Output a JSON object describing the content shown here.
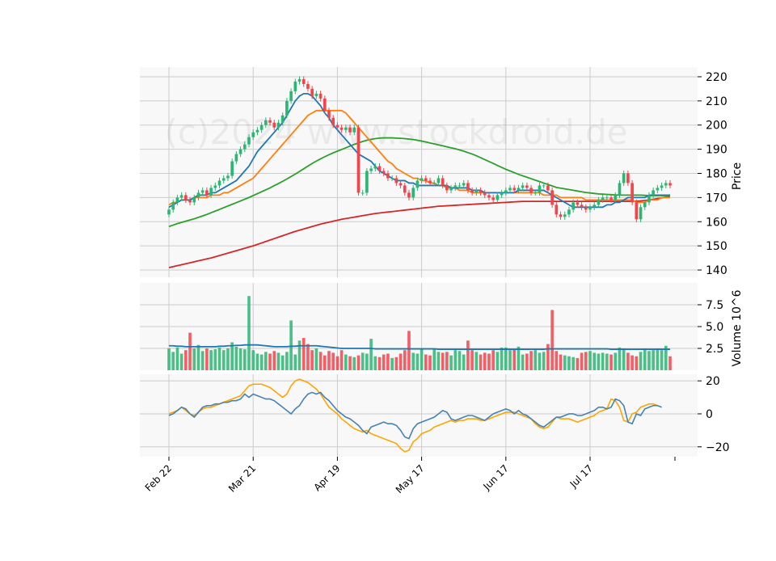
{
  "watermark": "(c)2024 www.stockdroid.de",
  "colors": {
    "up": "#2bb673",
    "down": "#f2444c",
    "ma1": "#1f77b4",
    "ma2": "#ff7f0e",
    "ma3": "#2ca02c",
    "ma4": "#d62728",
    "vol_ma": "#1f77b4",
    "osc_fast": "#4682b4",
    "osc_slow": "#ffa500",
    "panel_bg": "#f8f8f8",
    "grid": "#cccccc"
  },
  "chart_data": {
    "type": "candlestick",
    "x_tick_labels": [
      "Feb 22",
      "Mar 21",
      "Apr 19",
      "May 17",
      "Jun 17",
      "Jul 17"
    ],
    "x_tick_index": [
      0,
      20,
      40,
      60,
      80,
      100
    ],
    "panels": {
      "price": {
        "ylabel": "Price",
        "ylim": [
          137,
          224
        ],
        "yticks": [
          140,
          150,
          160,
          170,
          180,
          190,
          200,
          210,
          220
        ],
        "close": [
          165,
          168,
          170,
          171,
          169,
          168,
          170,
          172,
          173,
          171,
          174,
          175,
          177,
          178,
          179,
          185,
          188,
          190,
          192,
          195,
          197,
          198,
          200,
          202,
          201,
          199,
          201,
          204,
          210,
          214,
          218,
          219,
          217,
          215,
          212,
          213,
          211,
          206,
          203,
          200,
          199,
          198,
          199,
          197,
          199,
          172,
          172,
          181,
          182,
          183,
          181,
          180,
          178,
          178,
          176,
          175,
          172,
          170,
          174,
          177,
          178,
          177,
          176,
          176,
          178,
          175,
          173,
          174,
          175,
          175,
          176,
          173,
          172,
          173,
          172,
          171,
          170,
          169,
          171,
          172,
          173,
          174,
          173,
          174,
          175,
          174,
          172,
          172,
          175,
          175,
          173,
          167,
          163,
          162,
          163,
          165,
          168,
          167,
          166,
          165,
          166,
          167,
          169,
          170,
          170,
          169,
          171,
          176,
          180,
          176,
          168,
          161,
          166,
          168,
          171,
          173,
          174,
          175,
          176,
          175
        ],
        "ma_fast": [
          166,
          167,
          168,
          169,
          169,
          169,
          170,
          171,
          171,
          171,
          172,
          172,
          173,
          174,
          175,
          176,
          177,
          179,
          181,
          183,
          186,
          189,
          191,
          193,
          195,
          197,
          199,
          201,
          204,
          207,
          210,
          212,
          213,
          213,
          212,
          210,
          208,
          205,
          203,
          200,
          198,
          196,
          194,
          192,
          190,
          188,
          187,
          186,
          185,
          183,
          181,
          180,
          179,
          178,
          177,
          177,
          177,
          176,
          176,
          175,
          175,
          175,
          175,
          175,
          175,
          175,
          175,
          174,
          174,
          174,
          174,
          174,
          173,
          173,
          173,
          172,
          172,
          172,
          172,
          172,
          172,
          172,
          172,
          173,
          173,
          173,
          173,
          173,
          173,
          173,
          172,
          171,
          170,
          169,
          168,
          167,
          166,
          166,
          166,
          166,
          166,
          166,
          166,
          166,
          167,
          167,
          168,
          168,
          169,
          170,
          170,
          170,
          170,
          170,
          171,
          171,
          171,
          171,
          171,
          171
        ],
        "ma_mid": [
          167,
          168,
          168,
          169,
          169,
          169,
          170,
          170,
          170,
          170,
          171,
          171,
          171,
          172,
          172,
          173,
          174,
          175,
          176,
          177,
          178,
          180,
          182,
          184,
          186,
          188,
          190,
          192,
          194,
          196,
          198,
          200,
          202,
          204,
          205,
          206,
          206,
          206,
          206,
          206,
          206,
          206,
          205,
          203,
          201,
          199,
          197,
          195,
          193,
          191,
          189,
          187,
          185,
          184,
          182,
          181,
          180,
          179,
          178,
          178,
          177,
          177,
          176,
          176,
          175,
          175,
          174,
          174,
          174,
          173,
          173,
          173,
          172,
          172,
          172,
          172,
          172,
          172,
          172,
          172,
          172,
          172,
          172,
          172,
          172,
          172,
          172,
          172,
          172,
          171,
          171,
          171,
          171,
          170,
          170,
          170,
          170,
          170,
          170,
          169,
          169,
          169,
          169,
          169,
          169,
          169,
          169,
          169,
          169,
          169,
          169,
          168,
          168,
          168,
          169,
          169,
          169,
          170,
          170,
          170
        ],
        "ma_slow": [
          158,
          158.6,
          159.2,
          159.7,
          160.2,
          160.7,
          161.2,
          161.8,
          162.4,
          163.0,
          163.7,
          164.4,
          165.1,
          165.8,
          166.5,
          167.2,
          167.9,
          168.6,
          169.3,
          170.0,
          170.8,
          171.6,
          172.4,
          173.2,
          174.0,
          174.9,
          175.8,
          176.7,
          177.7,
          178.7,
          179.7,
          180.8,
          181.9,
          183.0,
          184.1,
          185.1,
          186.0,
          186.9,
          187.7,
          188.5,
          189.2,
          189.9,
          190.6,
          191.3,
          192.0,
          192.6,
          193.2,
          193.7,
          194.1,
          194.4,
          194.6,
          194.7,
          194.7,
          194.7,
          194.6,
          194.5,
          194.4,
          194.2,
          194.0,
          193.7,
          193.4,
          193.0,
          192.6,
          192.2,
          191.8,
          191.4,
          191.0,
          190.6,
          190.2,
          189.7,
          189.2,
          188.6,
          188.0,
          187.3,
          186.5,
          185.7,
          184.9,
          184.1,
          183.3,
          182.5,
          181.7,
          181.0,
          180.3,
          179.6,
          179.0,
          178.4,
          177.8,
          177.2,
          176.6,
          176.0,
          175.4,
          174.8,
          174.2,
          173.9,
          173.6,
          173.3,
          173.0,
          172.7,
          172.4,
          172.1,
          171.9,
          171.7,
          171.5,
          171.4,
          171.3,
          171.2,
          171.1,
          171.0,
          171.0,
          171.0,
          171.0,
          171.0,
          171.0,
          170.9,
          170.8,
          170.8,
          170.8,
          170.8,
          170.8,
          170.8
        ],
        "ma_long": [
          141,
          141.4,
          141.8,
          142.2,
          142.6,
          143.0,
          143.4,
          143.8,
          144.2,
          144.6,
          145.0,
          145.5,
          146.0,
          146.5,
          147.0,
          147.5,
          148.0,
          148.5,
          149.0,
          149.5,
          150.0,
          150.6,
          151.2,
          151.8,
          152.4,
          153.0,
          153.6,
          154.2,
          154.8,
          155.4,
          156.0,
          156.5,
          157.0,
          157.5,
          158.0,
          158.5,
          159.0,
          159.4,
          159.8,
          160.2,
          160.6,
          161.0,
          161.3,
          161.6,
          161.9,
          162.2,
          162.5,
          162.8,
          163.1,
          163.4,
          163.6,
          163.8,
          164.0,
          164.2,
          164.4,
          164.6,
          164.8,
          165.0,
          165.2,
          165.4,
          165.6,
          165.8,
          166.0,
          166.2,
          166.4,
          166.5,
          166.6,
          166.7,
          166.8,
          166.9,
          167.0,
          167.1,
          167.2,
          167.3,
          167.4,
          167.5,
          167.6,
          167.7,
          167.8,
          167.9,
          168.0,
          168.1,
          168.2,
          168.3,
          168.4,
          168.4,
          168.4,
          168.4,
          168.4,
          168.4,
          168.4,
          168.4,
          168.4,
          168.4,
          168.4,
          168.4,
          168.4,
          168.4,
          168.4,
          168.4,
          168.4,
          168.4,
          168.4,
          168.4,
          168.4,
          168.4,
          168.4,
          168.4,
          168.4,
          168.4,
          168.4,
          168.5,
          168.6,
          168.8,
          169.0,
          169.3,
          169.6,
          169.9,
          170.2,
          170.5
        ]
      },
      "volume": {
        "ylabel": "Volume  10^6",
        "ylim": [
          0,
          10
        ],
        "yticks": [
          2.5,
          5.0,
          7.5
        ],
        "ytick_labels": [
          "2.5",
          "5.0",
          "7.5"
        ],
        "values": [
          2.5,
          2.1,
          2.6,
          1.9,
          2.3,
          4.3,
          2.5,
          2.9,
          2.2,
          2.5,
          2.3,
          2.4,
          2.6,
          2.3,
          2.5,
          3.2,
          2.7,
          2.5,
          2.4,
          8.5,
          2.3,
          1.9,
          1.8,
          2.1,
          1.9,
          2.2,
          2.0,
          1.7,
          2.1,
          5.7,
          1.8,
          3.4,
          3.7,
          3.0,
          2.3,
          2.5,
          2.1,
          1.7,
          2.2,
          2.0,
          1.6,
          2.3,
          1.8,
          1.6,
          1.5,
          1.7,
          2.0,
          1.9,
          3.6,
          1.6,
          1.5,
          1.8,
          1.9,
          1.4,
          1.5,
          1.9,
          2.3,
          4.5,
          2.0,
          1.9,
          2.5,
          1.8,
          1.7,
          2.4,
          2.1,
          2.0,
          2.1,
          1.7,
          2.3,
          2.2,
          1.8,
          3.4,
          2.3,
          2.1,
          1.8,
          2.0,
          1.9,
          2.3,
          2.1,
          2.6,
          2.6,
          2.3,
          2.4,
          2.7,
          1.8,
          1.9,
          2.2,
          2.3,
          2.0,
          2.1,
          3.0,
          6.9,
          2.2,
          1.8,
          1.7,
          1.6,
          1.5,
          1.4,
          2.0,
          2.1,
          2.2,
          2.0,
          1.9,
          2.0,
          1.9,
          1.8,
          2.0,
          2.6,
          2.5,
          2.0,
          1.7,
          1.6,
          2.1,
          2.5,
          2.2,
          2.3,
          2.5,
          2.3,
          2.8,
          1.6
        ],
        "ma": [
          2.8,
          2.8,
          2.75,
          2.75,
          2.7,
          2.7,
          2.7,
          2.7,
          2.7,
          2.7,
          2.7,
          2.7,
          2.75,
          2.75,
          2.8,
          2.8,
          2.85,
          2.85,
          2.9,
          2.9,
          2.9,
          2.9,
          2.85,
          2.8,
          2.75,
          2.7,
          2.7,
          2.7,
          2.7,
          2.75,
          2.75,
          2.8,
          2.8,
          2.8,
          2.8,
          2.8,
          2.75,
          2.7,
          2.65,
          2.6,
          2.55,
          2.5,
          2.5,
          2.5,
          2.5,
          2.5,
          2.5,
          2.5,
          2.5,
          2.45,
          2.45,
          2.45,
          2.45,
          2.45,
          2.45,
          2.45,
          2.45,
          2.45,
          2.45,
          2.45,
          2.45,
          2.45,
          2.45,
          2.45,
          2.4,
          2.4,
          2.4,
          2.4,
          2.4,
          2.4,
          2.4,
          2.4,
          2.4,
          2.4,
          2.4,
          2.4,
          2.4,
          2.4,
          2.4,
          2.4,
          2.4,
          2.4,
          2.4,
          2.4,
          2.4,
          2.4,
          2.4,
          2.4,
          2.4,
          2.4,
          2.45,
          2.45,
          2.45,
          2.45,
          2.45,
          2.45,
          2.45,
          2.45,
          2.45,
          2.45,
          2.45,
          2.45,
          2.45,
          2.45,
          2.45,
          2.4,
          2.4,
          2.4,
          2.4,
          2.4,
          2.4,
          2.4,
          2.4,
          2.4,
          2.4,
          2.4,
          2.4,
          2.4,
          2.4,
          2.4
        ]
      },
      "oscillator": {
        "ylim": [
          -26,
          24
        ],
        "yticks": [
          -20,
          0,
          20
        ],
        "ytick_labels": [
          "−20",
          "0",
          "20"
        ],
        "fast": [
          -1,
          0,
          2,
          4,
          3,
          0,
          -2,
          1,
          4,
          5,
          5,
          6,
          6,
          7,
          7,
          8,
          8,
          9,
          12,
          10,
          12,
          11,
          10,
          9,
          9,
          8,
          6,
          4,
          2,
          0,
          3,
          5,
          9,
          12,
          13,
          12,
          13,
          10,
          8,
          5,
          2,
          0,
          -2,
          -3,
          -5,
          -7,
          -10,
          -12,
          -8,
          -7,
          -6,
          -5,
          -6,
          -6,
          -7,
          -10,
          -14,
          -15,
          -9,
          -6,
          -5,
          -4,
          -3,
          -2,
          0,
          2,
          1,
          -3,
          -4,
          -3,
          -2,
          -1,
          -1,
          -2,
          -3,
          -4,
          -2,
          0,
          1,
          2,
          3,
          2,
          0,
          2,
          0,
          -1,
          -3,
          -5,
          -7,
          -8,
          -6,
          -4,
          -2,
          -2,
          -1,
          0,
          0,
          -1,
          -1,
          0,
          1,
          2,
          4,
          4,
          3,
          4,
          9,
          8,
          5,
          -5,
          -6,
          0,
          -1,
          3,
          4,
          5,
          5,
          4
        ],
        "slow": [
          0,
          1,
          2,
          4,
          2,
          0,
          -1,
          1,
          3,
          4,
          4,
          5,
          6,
          7,
          8,
          9,
          10,
          11,
          14,
          17,
          18,
          18,
          18,
          17,
          16,
          14,
          12,
          10,
          12,
          17,
          20,
          21,
          20,
          19,
          17,
          15,
          12,
          8,
          4,
          2,
          0,
          -3,
          -5,
          -7,
          -9,
          -10,
          -11,
          -10,
          -12,
          -13,
          -14,
          -15,
          -16,
          -17,
          -18,
          -21,
          -23,
          -22,
          -17,
          -15,
          -12,
          -11,
          -10,
          -8,
          -7,
          -6,
          -5,
          -4,
          -5,
          -4,
          -4,
          -3,
          -3,
          -3,
          -4,
          -4,
          -3,
          -2,
          -1,
          0,
          1,
          1,
          1,
          0,
          -1,
          -2,
          -3,
          -6,
          -8,
          -9,
          -8,
          -5,
          -2,
          -3,
          -3,
          -3,
          -4,
          -5,
          -4,
          -3,
          -2,
          -1,
          1,
          2,
          3,
          9,
          8,
          4,
          -4,
          -5,
          0,
          1,
          4,
          5,
          6,
          6,
          5
        ]
      }
    }
  }
}
